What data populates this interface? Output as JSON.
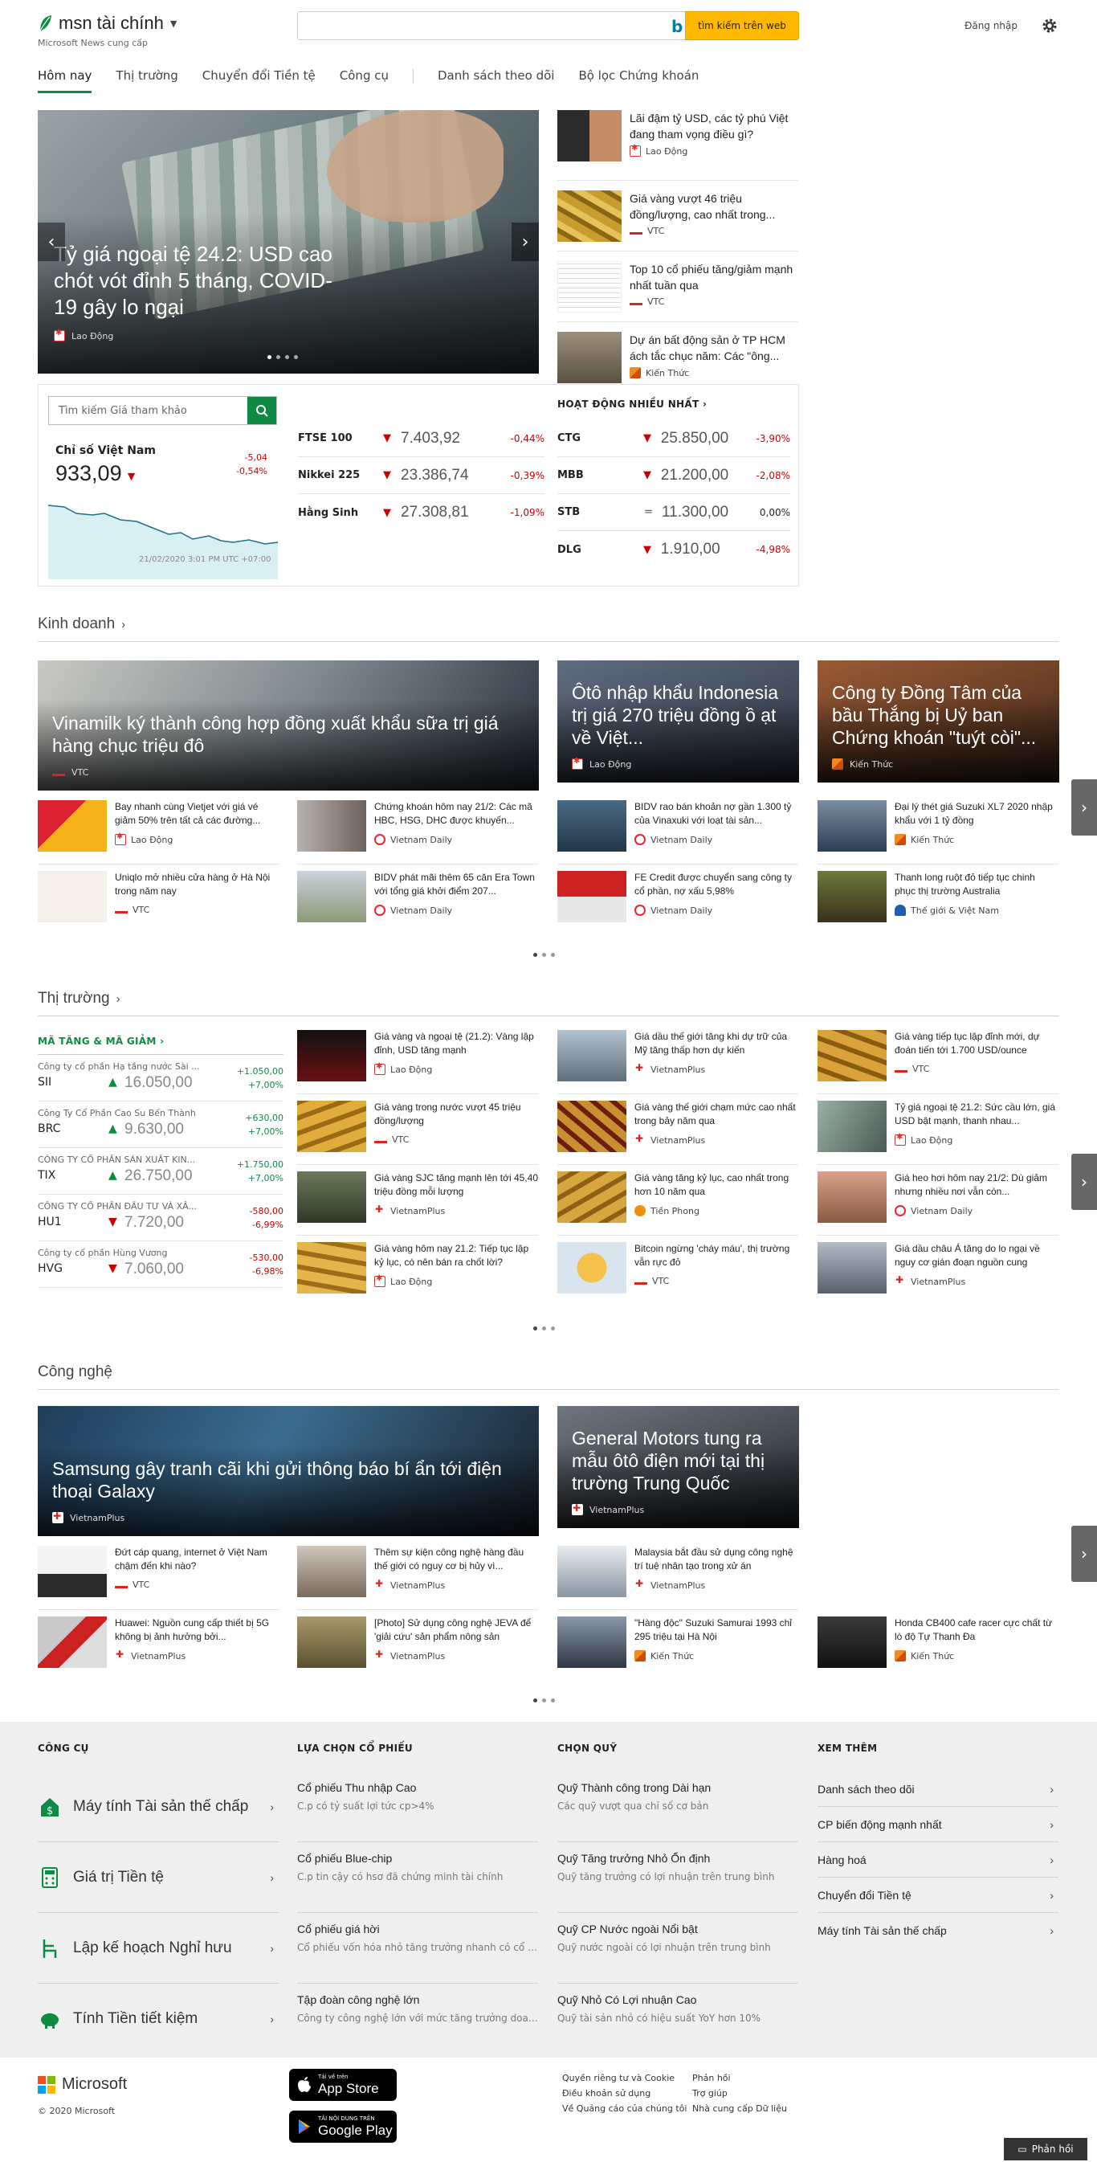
{
  "header": {
    "brand": "msn tài chính",
    "sub": "Microsoft News cung cấp",
    "search_placeholder": "",
    "search_button": "tìm kiếm trên web",
    "signin": "Đăng nhập"
  },
  "nav": [
    "Hôm nay",
    "Thị trường",
    "Chuyển đổi Tiền tệ",
    "Công cụ",
    "Danh sách theo dõi",
    "Bộ lọc Chứng khoán"
  ],
  "hero": {
    "title": "Tỷ giá ngoại tệ 24.2: USD cao chót vót đỉnh 5 tháng, COVID-19 gây lo ngại",
    "source": "Lao Động"
  },
  "side": [
    {
      "title": "Lãi đậm tỷ USD, các tỷ phú Việt đang tham vọng điều gì?",
      "source": "Lao Động",
      "pub": "ld"
    },
    {
      "title": "Giá vàng vượt 46 triệu đồng/lượng, cao nhất trong...",
      "source": "VTC",
      "pub": "vtc"
    },
    {
      "title": "Top 10 cổ phiếu tăng/giảm mạnh nhất tuần qua",
      "source": "VTC",
      "pub": "vtc"
    },
    {
      "title": "Dự án bất động sản ở TP HCM ách tắc chục năm: Các \"ông...",
      "source": "Kiến Thức",
      "pub": "kt"
    }
  ],
  "market": {
    "search_placeholder": "Tìm kiếm Giá tham khảo",
    "vn_title": "Chỉ số Việt Nam",
    "vn_value": "933,09",
    "vn_change": "-5,04",
    "vn_pct": "-0,54%",
    "vn_time": "21/02/2020 3:01 PM UTC +07:00",
    "indices": [
      {
        "name": "FTSE 100",
        "value": "7.403,92",
        "pct": "-0,44%"
      },
      {
        "name": "Nikkei 225",
        "value": "23.386,74",
        "pct": "-0,39%"
      },
      {
        "name": "Hằng Sinh",
        "value": "27.308,81",
        "pct": "-1,09%"
      }
    ],
    "active_title": "HOẠT ĐỘNG NHIỀU NHẤT",
    "active": [
      {
        "name": "CTG",
        "value": "25.850,00",
        "pct": "-3,90%",
        "dir": "down"
      },
      {
        "name": "MBB",
        "value": "21.200,00",
        "pct": "-2,08%",
        "dir": "down"
      },
      {
        "name": "STB",
        "value": "11.300,00",
        "pct": "0,00%",
        "dir": "eq"
      },
      {
        "name": "DLG",
        "value": "1.910,00",
        "pct": "-4,98%",
        "dir": "down"
      }
    ]
  },
  "business": {
    "heading": "Kinh doanh",
    "big": [
      {
        "title": "Vinamilk ký thành công hợp đồng xuất khẩu sữa trị giá hàng chục triệu đô",
        "source": "VTC",
        "pub": "vtc"
      },
      {
        "title": "Ôtô nhập khẩu Indonesia trị giá 270 triệu đồng ồ ạt về Việt...",
        "source": "Lao Động",
        "pub": "ld"
      },
      {
        "title": "Công ty Đồng Tâm của bầu Thắng bị Uỷ ban Chứng khoán \"tuýt còi\"...",
        "source": "Kiến Thức",
        "pub": "kt"
      }
    ],
    "small": [
      {
        "title": "Bay nhanh cùng Vietjet với giá vé giảm 50% trên tất cả các đường...",
        "source": "Lao Động",
        "pub": "ld"
      },
      {
        "title": "Chứng khoán hôm nay 21/2: Các mã HBC, HSG, DHC được khuyến...",
        "source": "Vietnam Daily",
        "pub": "vnd"
      },
      {
        "title": "BIDV rao bán khoản nợ gần 1.300 tỷ của Vinaxuki với loạt tài sản...",
        "source": "Vietnam Daily",
        "pub": "vnd"
      },
      {
        "title": "Đại lý thét giá Suzuki XL7 2020 nhập khẩu với 1 tỷ đồng",
        "source": "Kiến Thức",
        "pub": "kt"
      },
      {
        "title": "Uniqlo mở nhiều cửa hàng ở Hà Nội trong năm nay",
        "source": "VTC",
        "pub": "vtc"
      },
      {
        "title": "BIDV phát mãi thêm 65 căn Era Town với tổng giá khởi điểm 207...",
        "source": "Vietnam Daily",
        "pub": "vnd"
      },
      {
        "title": "FE Credit được chuyển sang công ty cổ phần, nợ xấu 5,98%",
        "source": "Vietnam Daily",
        "pub": "vnd"
      },
      {
        "title": "Thanh long ruột đỏ tiếp tục chinh phục thị trường Australia",
        "source": "Thế giới & Việt Nam",
        "pub": "tgvn"
      }
    ]
  },
  "markets": {
    "heading": "Thị trường",
    "movers_title": "MÃ TĂNG & MÃ GIẢM",
    "movers": [
      {
        "company": "Công ty cổ phần Hạ tầng nước Sài ...",
        "ticker": "SII",
        "price": "16.050,00",
        "change": "+1.050,00",
        "pct": "+7,00%",
        "dir": "up"
      },
      {
        "company": "Công Ty Cổ Phần Cao Su Bến Thành",
        "ticker": "BRC",
        "price": "9.630,00",
        "change": "+630,00",
        "pct": "+7,00%",
        "dir": "up"
      },
      {
        "company": "CÔNG TY CỔ PHẦN SẢN XUẤT KIN...",
        "ticker": "TIX",
        "price": "26.750,00",
        "change": "+1.750,00",
        "pct": "+7,00%",
        "dir": "up"
      },
      {
        "company": "CÔNG TY CỔ PHẦN ĐẦU TƯ VÀ XÂ...",
        "ticker": "HU1",
        "price": "7.720,00",
        "change": "-580,00",
        "pct": "-6,99%",
        "dir": "down"
      },
      {
        "company": "Công ty cổ phần Hùng Vương",
        "ticker": "HVG",
        "price": "7.060,00",
        "change": "-530,00",
        "pct": "-6,98%",
        "dir": "down"
      }
    ],
    "small": [
      {
        "title": "Giá vàng và ngoại tệ (21.2): Vàng lập đỉnh, USD tăng mạnh",
        "source": "Lao Động",
        "pub": "ld"
      },
      {
        "title": "Giá dầu thế giới tăng khi dự trữ của Mỹ tăng thấp hơn dự kiến",
        "source": "VietnamPlus",
        "pub": "vp"
      },
      {
        "title": "Giá vàng tiếp tục lập đỉnh mới, dự đoán tiến tới 1.700 USD/ounce",
        "source": "VTC",
        "pub": "vtc"
      },
      {
        "title": "Giá vàng trong nước vượt 45 triệu đồng/lượng",
        "source": "VTC",
        "pub": "vtc"
      },
      {
        "title": "Giá vàng thế giới chạm mức cao nhất trong bảy năm qua",
        "source": "VietnamPlus",
        "pub": "vp"
      },
      {
        "title": "Tỷ giá ngoại tệ 21.2: Sức cầu lớn, giá USD bật mạnh, thanh nhau...",
        "source": "Lao Động",
        "pub": "ld"
      },
      {
        "title": "Giá vàng SJC tăng mạnh lên tới 45,40 triệu đồng mỗi lượng",
        "source": "VietnamPlus",
        "pub": "vp"
      },
      {
        "title": "Giá vàng tăng kỷ lục, cao nhất trong hơn 10 năm qua",
        "source": "Tiền Phong",
        "pub": "tp"
      },
      {
        "title": "Giá heo hơi hôm nay 21/2: Dù giảm nhưng nhiều nơi vẫn còn...",
        "source": "Vietnam Daily",
        "pub": "vnd"
      },
      {
        "title": "Giá vàng hôm nay 21.2: Tiếp tục lập kỷ lục, có nên bán ra chốt lời?",
        "source": "Lao Động",
        "pub": "ld"
      },
      {
        "title": "Bitcoin ngừng 'cháy máu', thị trường vẫn rực đỏ",
        "source": "VTC",
        "pub": "vtc"
      },
      {
        "title": "Giá dầu châu Á tăng do lo ngại về nguy cơ gián đoạn nguồn cung",
        "source": "VietnamPlus",
        "pub": "vp"
      }
    ]
  },
  "tech": {
    "heading": "Công nghệ",
    "big": [
      {
        "title": "Samsung gây tranh cãi khi gửi thông báo bí ẩn tới điện thoại Galaxy",
        "source": "VietnamPlus",
        "pub": "vp"
      },
      {
        "title": "General Motors tung ra mẫu ôtô điện mới tại thị trường Trung Quốc",
        "source": "VietnamPlus",
        "pub": "vp"
      }
    ],
    "small": [
      {
        "title": "Đứt cáp quang, internet ở Việt Nam chậm đến khi nào?",
        "source": "VTC",
        "pub": "vtc"
      },
      {
        "title": "Thêm sự kiện công nghệ hàng đầu thế giới có nguy cơ bị hủy vì...",
        "source": "VietnamPlus",
        "pub": "vp"
      },
      {
        "title": "Malaysia bắt đầu sử dụng công nghệ trí tuệ nhân tạo trong xử án",
        "source": "VietnamPlus",
        "pub": "vp"
      },
      {
        "title": "Huawei: Nguồn cung cấp thiết bị 5G không bị ảnh hưởng bởi...",
        "source": "VietnamPlus",
        "pub": "vp"
      },
      {
        "title": "[Photo] Sử dụng công nghệ JEVA để 'giải cứu' sản phẩm nông sản",
        "source": "VietnamPlus",
        "pub": "vp"
      },
      {
        "title": "\"Hàng độc\" Suzuki Samurai 1993 chỉ 295 triệu tại Hà Nội",
        "source": "Kiến Thức",
        "pub": "kt"
      },
      {
        "title": "Honda CB400 cafe racer cực chất từ lò độ Tự Thanh Đa",
        "source": "Kiến Thức",
        "pub": "kt"
      }
    ]
  },
  "tools": {
    "col1_title": "CÔNG CỤ",
    "col1": [
      "Máy tính Tài sản thế chấp",
      "Giá trị Tiền tệ",
      "Lập kế hoạch Nghỉ hưu",
      "Tính Tiền tiết kiệm"
    ],
    "col2_title": "LỰA CHỌN CỔ PHIẾU",
    "col2": [
      {
        "t": "Cổ phiếu Thu nhập Cao",
        "d": "C.p có tỷ suất lợi tức cp>4%"
      },
      {
        "t": "Cổ phiếu Blue-chip",
        "d": "C.p tin cậy có hsơ đã chứng minh tài chính"
      },
      {
        "t": "Cổ phiếu giá hời",
        "d": "Cổ phiếu vốn hóa nhỏ tăng trưởng nhanh có cổ tứ..."
      },
      {
        "t": "Tập đoàn công nghệ lớn",
        "d": "Công ty công nghệ lớn với mức tăng trưởng doan..."
      }
    ],
    "col3_title": "CHỌN QUỸ",
    "col3": [
      {
        "t": "Quỹ Thành công trong Dài hạn",
        "d": "Các quỹ vượt qua chỉ số cơ bản"
      },
      {
        "t": "Quỹ Tăng trưởng Nhỏ Ổn định",
        "d": "Quỹ tăng trưởng có lợi nhuận trên trung bình"
      },
      {
        "t": "Quỹ CP Nước ngoài Nổi bật",
        "d": "Quỹ nước ngoài có lợi nhuận trên trung bình"
      },
      {
        "t": "Quỹ Nhỏ Có Lợi nhuận Cao",
        "d": "Quỹ tài sản nhỏ có hiệu suất YoY hơn 10%"
      }
    ],
    "col4_title": "XEM THÊM",
    "col4": [
      "Danh sách theo dõi",
      "CP biến động mạnh nhất",
      "Hàng hoá",
      "Chuyển đổi Tiền tệ",
      "Máy tính Tài sản thế chấp"
    ]
  },
  "footer": {
    "brand": "Microsoft",
    "copyright": "© 2020 Microsoft",
    "appstore_small": "Tải về trên",
    "appstore": "App Store",
    "gplay_small": "TẢI NỘI DUNG TRÊN",
    "gplay": "Google Play",
    "links1": [
      "Quyền riêng tư và Cookie",
      "Điều khoản sử dụng",
      "Về Quảng cáo của chúng tôi"
    ],
    "links2": [
      "Phản hồi",
      "Trợ giúp",
      "Nhà cung cấp Dữ liệu"
    ],
    "feedback": "Phản hồi"
  },
  "colors": {
    "accent": "#0f8a43",
    "down": "#c00000",
    "search_btn": "#ffb900"
  }
}
